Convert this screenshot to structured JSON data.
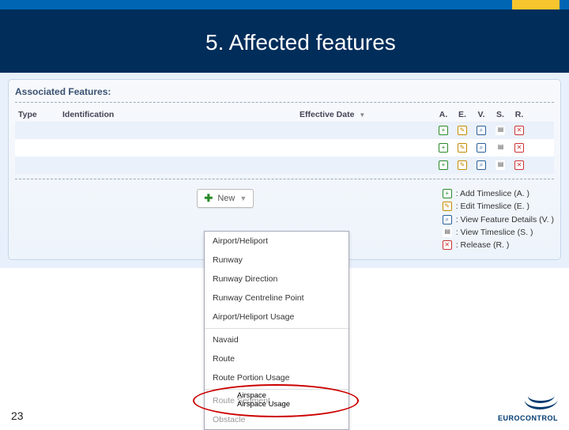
{
  "header": {
    "title": "5. Affected features"
  },
  "panel": {
    "title": "Associated Features:"
  },
  "columns": {
    "type": "Type",
    "identification": "Identification",
    "effective": "Effective Date",
    "a": "A.",
    "e": "E.",
    "v": "V.",
    "s": "S.",
    "r": "R."
  },
  "new_button": {
    "label": "New"
  },
  "legend": {
    "add": ": Add Timeslice (A. )",
    "edit": ": Edit Timeslice (E. )",
    "view": ": View Feature Details (V. )",
    "slice": ": View Timeslice (S. )",
    "release": ": Release (R. )"
  },
  "dropdown": {
    "items": [
      "Airport/Heliport",
      "Runway",
      "Runway Direction",
      "Runway Centreline Point",
      "Airport/Heliport Usage"
    ],
    "items2": [
      "Navaid",
      "Route",
      "Route Portion Usage"
    ],
    "items3_faded": [
      "Route Segment",
      "Obstacle"
    ]
  },
  "overlay": {
    "line1": "Airspace",
    "line2": "Airspace Usage"
  },
  "footer": {
    "page": "23",
    "brand": "EUROCONTROL"
  }
}
